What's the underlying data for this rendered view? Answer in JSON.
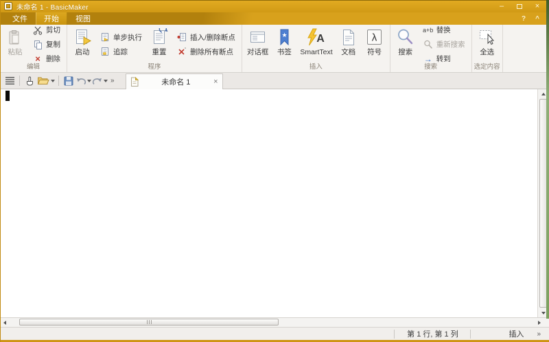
{
  "window": {
    "title": "未命名 1 - BasicMaker"
  },
  "titlebar_controls": {
    "minimize": "–",
    "close": "×",
    "help": "?",
    "collapse": "^"
  },
  "tabs": [
    {
      "label": "文件"
    },
    {
      "label": "开始"
    },
    {
      "label": "视图"
    }
  ],
  "ribbon": {
    "edit": {
      "label": "编辑",
      "paste": "粘贴",
      "cut": "剪切",
      "copy": "复制",
      "delete": "删除"
    },
    "program": {
      "label": "程序",
      "start": "启动",
      "step": "单步执行",
      "trace": "追踪",
      "reset": "重置",
      "toggle_breakpoint": "插入/删除断点",
      "clear_breakpoints": "删除所有断点"
    },
    "insert": {
      "label": "插入",
      "dialog": "对话框",
      "bookmark": "书签",
      "smarttext": "SmartText",
      "document": "文档",
      "symbol": "符号"
    },
    "search": {
      "label": "搜索",
      "search": "搜索",
      "replace": "替换",
      "replace_icon": "a+b",
      "search_again": "重新搜索",
      "goto": "转到"
    },
    "selection": {
      "label": "选定内容",
      "select_all": "全选"
    }
  },
  "toolbar": {
    "doc_tab_title": "未命名 1",
    "close": "×",
    "overflow": "»"
  },
  "statusbar": {
    "position": "第 1 行, 第 1 列",
    "mode": "插入",
    "overflow": "»"
  },
  "icons": {
    "lambda": "λ",
    "smarttext_letter": "A",
    "goto_arrow": "→",
    "delete_x": "×",
    "star": "★"
  },
  "colors": {
    "titlebar_gold": "#DCA41E",
    "tab_strip_dark": "#B2810D",
    "ribbon_bg": "#F5F3F0",
    "accent_border": "#CF9414",
    "bookmark_blue": "#4D7FD1",
    "lightning_yellow": "#F5C332",
    "delete_red": "#C23B2E"
  }
}
